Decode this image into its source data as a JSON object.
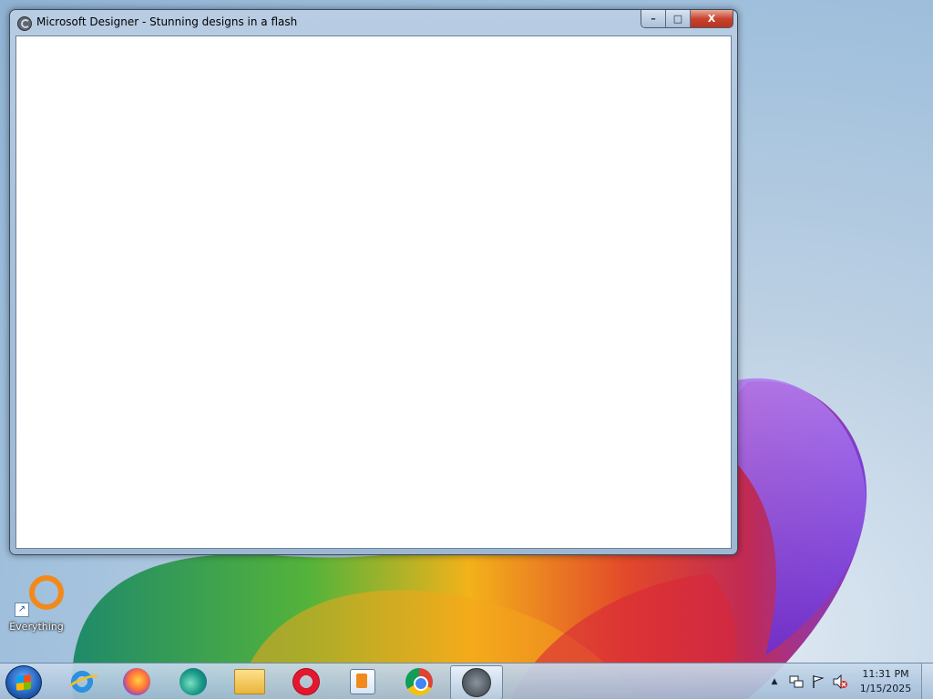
{
  "window": {
    "title": "Microsoft Designer - Stunning designs in a flash",
    "controls": {
      "minimize": "–",
      "maximize": "□",
      "close": "X"
    }
  },
  "desktop": {
    "icons": [
      {
        "label": "Everything",
        "icon": "everything-icon"
      }
    ]
  },
  "taskbar": {
    "start": {
      "icon": "windows-start-orb-icon"
    },
    "apps": [
      {
        "icon": "internet-explorer-icon"
      },
      {
        "icon": "firefox-icon"
      },
      {
        "icon": "edge-icon"
      },
      {
        "icon": "file-explorer-icon"
      },
      {
        "icon": "opera-icon"
      },
      {
        "icon": "media-player-icon"
      },
      {
        "icon": "chrome-icon"
      },
      {
        "icon": "designer-app-icon",
        "active": true
      }
    ],
    "tray": {
      "overflow": "▲",
      "time": "11:31 PM",
      "date": "1/15/2025",
      "icons": [
        "network-icon",
        "action-center-flag-icon",
        "volume-muted-icon"
      ]
    }
  },
  "colors": {
    "close_button": "#c8442f",
    "taskbar_bg": "#b8cde3",
    "wallpaper_sky": "#9fbfdc"
  }
}
